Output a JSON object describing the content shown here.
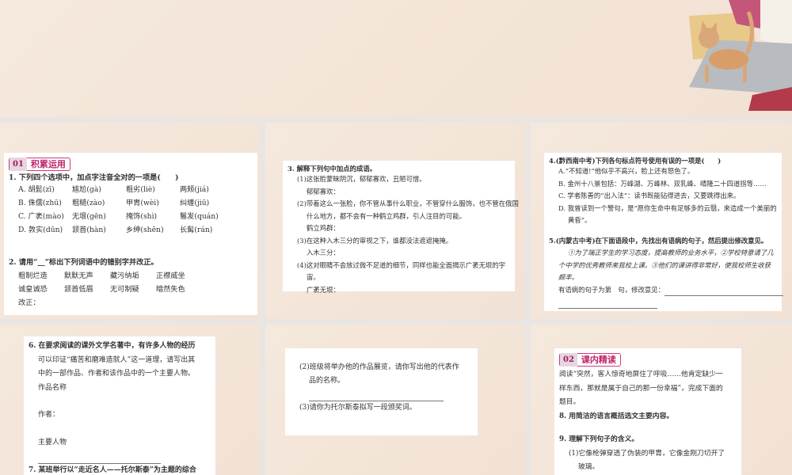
{
  "slides": [
    {
      "id": "top-partial"
    },
    {
      "section_num": "01",
      "section_title": "积累运用",
      "q1": "1. 下列四个选项中，加点字注音全对的一项是(　　)",
      "q1_options": [
        [
          "A. 胡髭(zī)",
          "尴尬(gà)",
          "粗劣(liè)",
          "两颊(jiá)"
        ],
        [
          "B. 侏儒(zhū)",
          "粗糙(zào)",
          "甲胄(wèi)",
          "纠缠(jiū)"
        ],
        [
          "C. 广袤(mào)",
          "无垠(gēn)",
          "掩饰(shì)",
          "鬈发(quán)"
        ],
        [
          "D. 敦实(dūn)",
          "颔首(hàn)",
          "乡绅(shēn)",
          "长髯(rán)"
        ]
      ],
      "q2": "2. 请用“__”标出下列词语中的错别字并改正。",
      "q2_words": [
        [
          "粗制烂造",
          "默默无声",
          "藏污纳垢",
          "正襟威坐"
        ],
        [
          "诚皇诚恐",
          "颔首低眉",
          "无可制疑",
          "暗然失色"
        ]
      ],
      "q2_fix": "改正："
    },
    {
      "q3": "3. 解释下列句中加点的成语。",
      "lines": [
        "(1)这张脸蒙昧阴沉，郁郁寡欢，丑陋可憎。",
        "郁郁寡欢：",
        "(2)带着这么一张脸，你不管从事什么职业，不管穿什么服饰，也不管在俄国",
        "什么地方，都不会有一种鹤立鸡群，引人注目的可能。",
        "鹤立鸡群：",
        "(3)在这种入木三分的审视之下，谁都没法遮遮掩掩。",
        "入木三分：",
        "(4)这对眼睛不会放过微不足道的细节，同样也能全面揭示广袤无垠的宇",
        "宙。",
        "广袤无垠："
      ]
    },
    {
      "q4": "4.(黔西南中考)下列各句标点符号使用有误的一项是(　　)",
      "q4_options": [
        "A.“不知道!”他似乎不高兴，脸上还有怒色了。",
        "B. 金州十八景包括：万峰湖、万峰林、双乳峰、晴隆二十四道拐等……",
        "C. 学者陈善的“出入法”：读书既能钻得进去，又要跳得出来。",
        "D. 我曾读到一个警句，是“愿你生命中有足够多的云翳，来造成一个美丽的",
        "黄昏”。"
      ],
      "q5": "5.(内蒙古中考)在下面语段中，先找出有语病的句子，然后提出修改意见。",
      "q5_lines": [
        "①为了端正学生的学习态度，提高教师的业务水平，②学校特意请了几",
        "个中学的优秀教师来我校上课。③他们的课讲得非常好，使我校师生收获",
        "颇丰。"
      ],
      "q5_answer": "有语病的句子为第　句，修改意见："
    },
    {
      "q6": [
        "6. 在要求阅读的课外文学名著中，有许多人物的经历",
        "可以印证“痛苦和磨难造就人”这一道理，请写出其",
        "中的一部作品、作者和该作品中的一个主要人物。"
      ],
      "work": "作品名称",
      "author": "作者：",
      "character": "主要人物",
      "q7": "7. 某班举行以“走近名人——托尔斯泰”为主题的综合"
    },
    {
      "lines": [
        "(2)班级将举办他的作品展览，请你写出他的代表作",
        "品的名称。",
        "(3)请你为托尔斯泰拟写一段颁奖词。"
      ]
    },
    {
      "section_num": "02",
      "section_title": "课内精读",
      "lines": [
        "阅读“突然，客人惊奇地屏住了呼吸……他肯定缺少一",
        "样东西，那就是属于自己的那一份幸福”，完成下面的",
        "题目。",
        "8. 用简洁的语言概括选文主要内容。",
        "9. 理解下列句子的含义。",
        "(1)它像枪弹穿透了伪装的甲胄，它像金刚刀切开了",
        "玻璃。"
      ]
    }
  ]
}
